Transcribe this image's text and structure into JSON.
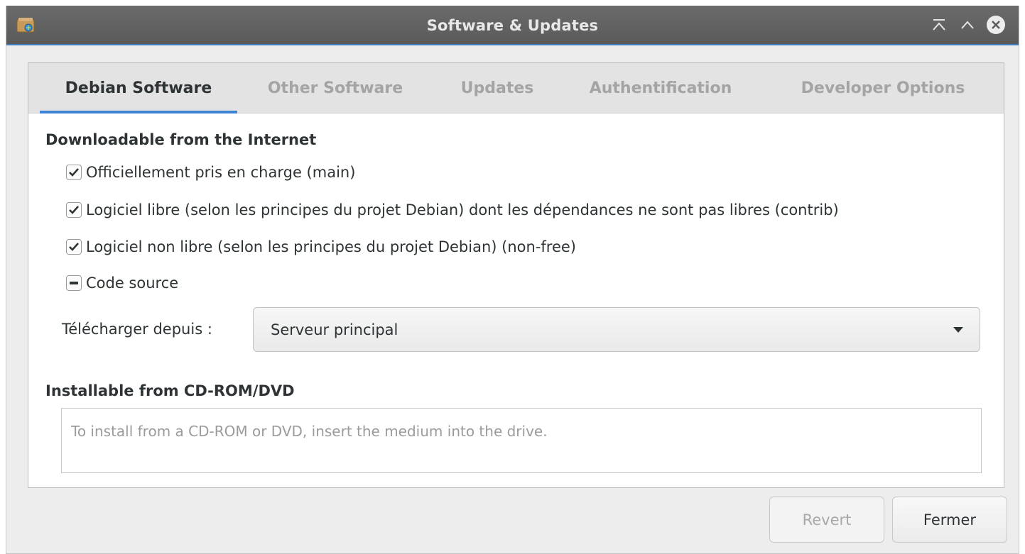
{
  "window": {
    "title": "Software & Updates",
    "icon": "software-properties-icon",
    "controls": [
      "minimize-icon",
      "maximize-icon",
      "close-icon"
    ]
  },
  "tabs": [
    {
      "label": "Debian Software",
      "active": true
    },
    {
      "label": "Other Software",
      "active": false
    },
    {
      "label": "Updates",
      "active": false
    },
    {
      "label": "Authentification",
      "active": false
    },
    {
      "label": "Developer Options",
      "active": false
    }
  ],
  "internet": {
    "heading": "Downloadable from the Internet",
    "options": [
      {
        "label": "Officiellement pris en charge (main)",
        "state": "checked"
      },
      {
        "label": "Logiciel libre (selon les principes du projet Debian) dont les dépendances ne sont pas libres (contrib)",
        "state": "checked"
      },
      {
        "label": "Logiciel non libre (selon les principes du projet Debian) (non-free)",
        "state": "checked"
      },
      {
        "label": "Code source",
        "state": "indeterminate"
      }
    ],
    "download_from_label": "Télécharger depuis :",
    "download_from_value": "Serveur principal"
  },
  "cdrom": {
    "heading": "Installable from CD-ROM/DVD",
    "placeholder": "To install from a CD-ROM or DVD, insert the medium into the drive."
  },
  "buttons": {
    "revert": "Revert",
    "close": "Fermer"
  },
  "colors": {
    "accent": "#3d84d6",
    "titlebar": "#5f5f5f"
  }
}
